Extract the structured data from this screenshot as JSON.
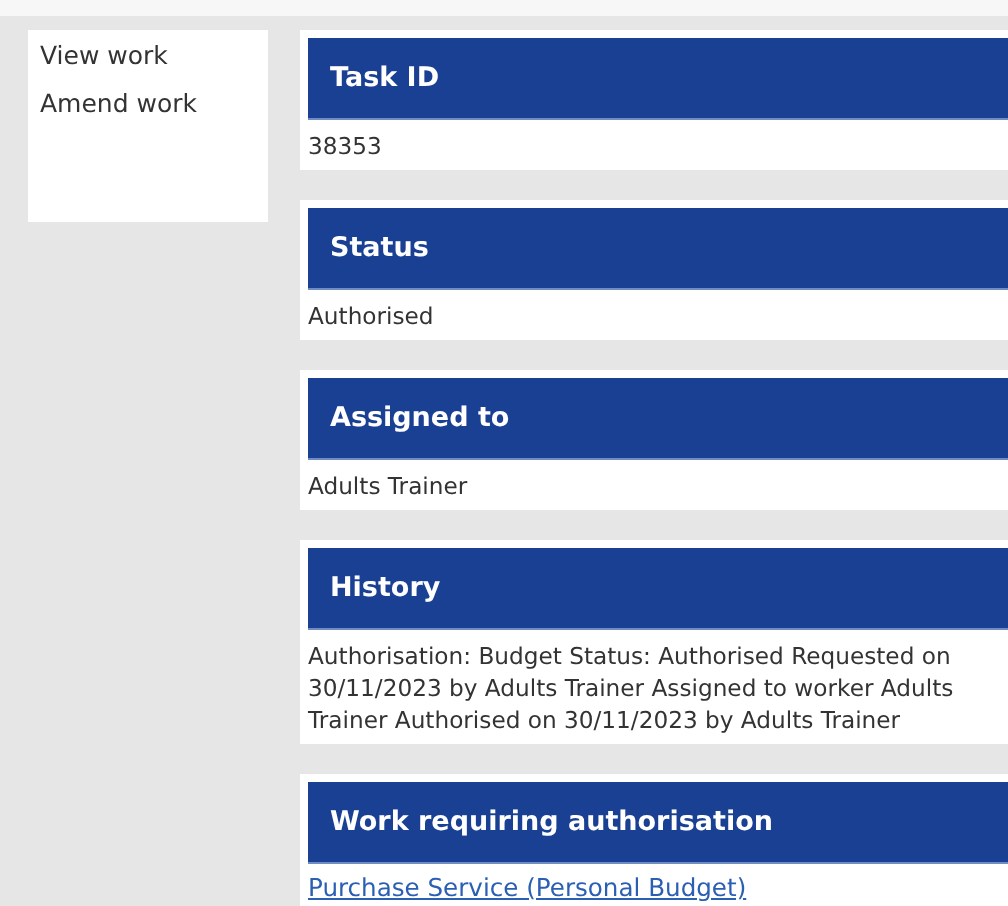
{
  "sidebar": {
    "items": [
      {
        "label": "View work"
      },
      {
        "label": "Amend work"
      }
    ]
  },
  "sections": [
    {
      "title": "Task ID",
      "kind": "text",
      "value": "38353"
    },
    {
      "title": "Status",
      "kind": "text",
      "value": "Authorised"
    },
    {
      "title": "Assigned to",
      "kind": "text",
      "value": "Adults Trainer"
    },
    {
      "title": "History",
      "kind": "text",
      "value": "Authorisation: Budget Status: Authorised Requested on 30/11/2023 by Adults Trainer Assigned to worker Adults Trainer Authorised on 30/11/2023 by Adults Trainer"
    },
    {
      "title": "Work requiring authorisation",
      "kind": "link",
      "value": "Purchase Service (Personal Budget)"
    }
  ]
}
